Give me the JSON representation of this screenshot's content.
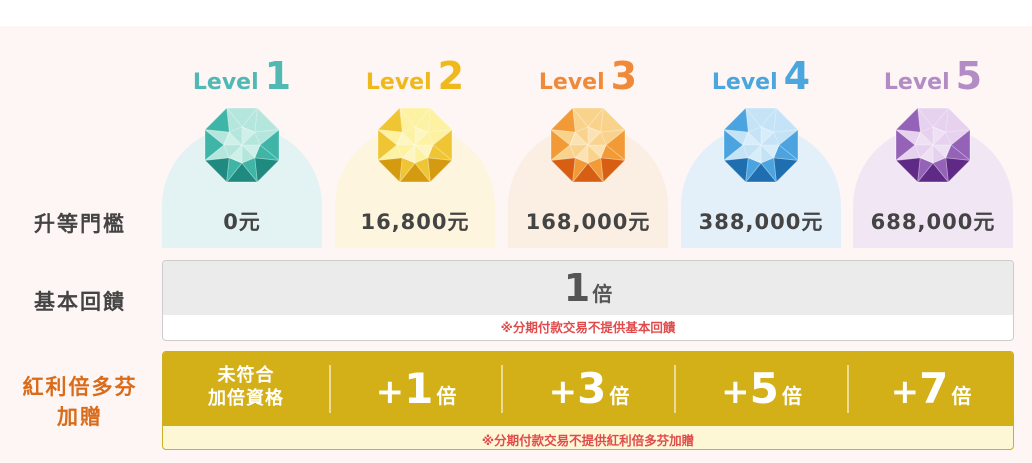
{
  "row_labels": {
    "threshold": "升等門檻",
    "base_reward": "基本回饋",
    "bonus_line1": "紅利倍多芬",
    "bonus_line2": "加贈"
  },
  "level_word": "Level",
  "levels": [
    {
      "num": "1",
      "threshold": "0元",
      "color": "#50b9b4",
      "bg": "#e3f2f2",
      "gem_dark": "#1f8a80",
      "gem_mid": "#3eb5a6",
      "gem_light": "#b5e6dd"
    },
    {
      "num": "2",
      "threshold": "16,800元",
      "color": "#f0b91b",
      "bg": "#fdf5dd",
      "gem_dark": "#d59b10",
      "gem_mid": "#f0c533",
      "gem_light": "#fdf1a2"
    },
    {
      "num": "3",
      "threshold": "168,000元",
      "color": "#ef8a3a",
      "bg": "#fbeee3",
      "gem_dark": "#d75f13",
      "gem_mid": "#f29a36",
      "gem_light": "#f9d38c"
    },
    {
      "num": "4",
      "threshold": "388,000元",
      "color": "#4aa6dd",
      "bg": "#e4f0f9",
      "gem_dark": "#1f6fb0",
      "gem_mid": "#4ba3e0",
      "gem_light": "#c4e3f7"
    },
    {
      "num": "5",
      "threshold": "688,000元",
      "color": "#b38cc6",
      "bg": "#f1e7f4",
      "gem_dark": "#5f2a86",
      "gem_mid": "#9462b7",
      "gem_light": "#e6d2ef"
    }
  ],
  "base": {
    "num": "1",
    "unit": "倍",
    "note": "※分期付款交易不提供基本回饋"
  },
  "bonus": {
    "first_line1": "未符合",
    "first_line2": "加倍資格",
    "cells": [
      {
        "plus": "+",
        "num": "1",
        "unit": "倍"
      },
      {
        "plus": "+",
        "num": "3",
        "unit": "倍"
      },
      {
        "plus": "+",
        "num": "5",
        "unit": "倍"
      },
      {
        "plus": "+",
        "num": "7",
        "unit": "倍"
      }
    ],
    "note": "※分期付款交易不提供紅利倍多芬加贈"
  },
  "colors": {
    "label_text": "#444444",
    "note_red": "#e04c4c",
    "bonus_gold": "#d3af18",
    "bonus_note_bg": "#fdf7d6",
    "base_gray": "#ebebeb"
  }
}
